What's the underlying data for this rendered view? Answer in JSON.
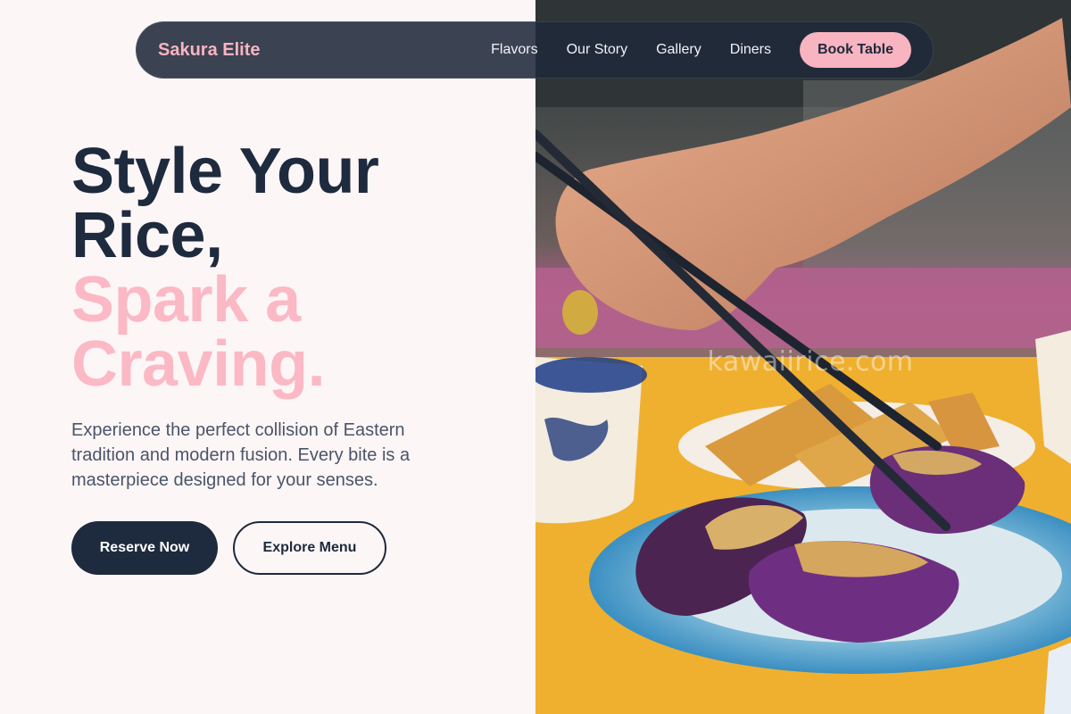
{
  "nav": {
    "brand": "Sakura Elite",
    "links": [
      "Flavors",
      "Our Story",
      "Gallery",
      "Diners"
    ],
    "cta": "Book Table"
  },
  "hero": {
    "headline_dark": [
      "Style Your",
      "Rice,"
    ],
    "headline_pink": [
      "Spark a",
      "Craving."
    ],
    "lede": "Experience the perfect collision of Eastern tradition and modern fusion. Every bite is a masterpiece designed for your senses.",
    "primary_cta": "Reserve Now",
    "secondary_cta": "Explore Menu"
  },
  "photo": {
    "watermark": "kawaiirice.com"
  },
  "colors": {
    "navy": "#1e2a3d",
    "pink": "#f8b4c0",
    "background": "#fdf6f7"
  }
}
